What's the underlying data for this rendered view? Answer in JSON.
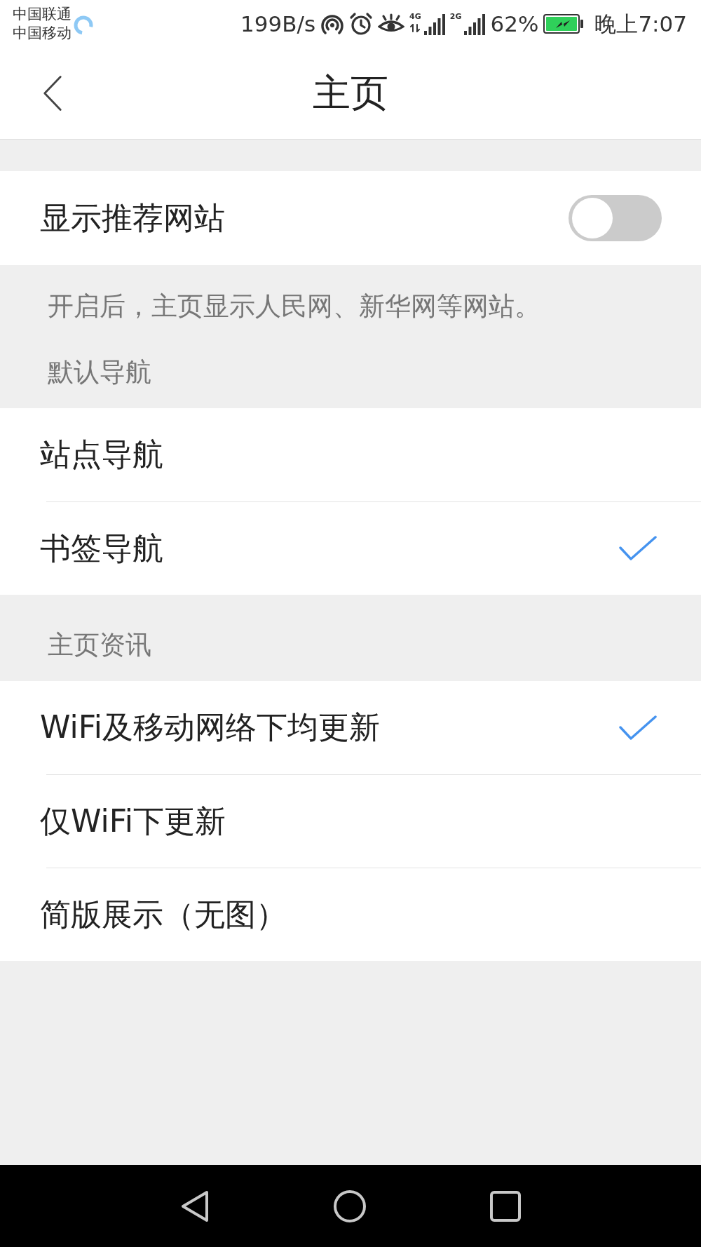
{
  "status_bar": {
    "carriers": [
      "中国联通",
      "中国移动"
    ],
    "network_speed": "199B/s",
    "signals": [
      {
        "type": "4G",
        "data_active": true
      },
      {
        "type": "2G",
        "data_active": false
      }
    ],
    "battery_percent": "62%",
    "time": "晚上7:07"
  },
  "header": {
    "title": "主页"
  },
  "toggle_row": {
    "label": "显示推荐网站",
    "on": false,
    "note": "开启后，主页显示人民网、新华网等网站。"
  },
  "groups": [
    {
      "title": "默认导航",
      "options": [
        {
          "label": "站点导航",
          "selected": false
        },
        {
          "label": "书签导航",
          "selected": true
        }
      ]
    },
    {
      "title": "主页资讯",
      "options": [
        {
          "label": "WiFi及移动网络下均更新",
          "selected": true
        },
        {
          "label": "仅WiFi下更新",
          "selected": false
        },
        {
          "label": "简版展示（无图）",
          "selected": false
        }
      ]
    }
  ]
}
